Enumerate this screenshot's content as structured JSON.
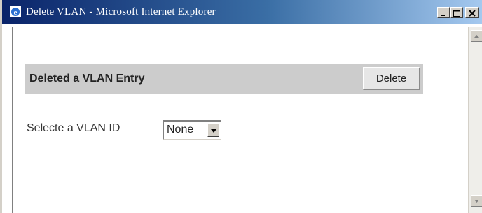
{
  "window": {
    "title": "Delete VLAN - Microsoft Internet Explorer",
    "icon": "internet-explorer-icon",
    "controls": [
      "minimize-icon",
      "maximize-icon",
      "close-icon"
    ]
  },
  "form": {
    "header_title": "Deleted a VLAN Entry",
    "delete_label": "Delete",
    "vlan_label": "Selecte a VLAN ID",
    "vlan_selected": "None"
  },
  "colors": {
    "titlebar_start": "#0a246a",
    "titlebar_end": "#a6caf0",
    "header_bar": "#cccccc",
    "chrome": "#d4d0c8"
  }
}
